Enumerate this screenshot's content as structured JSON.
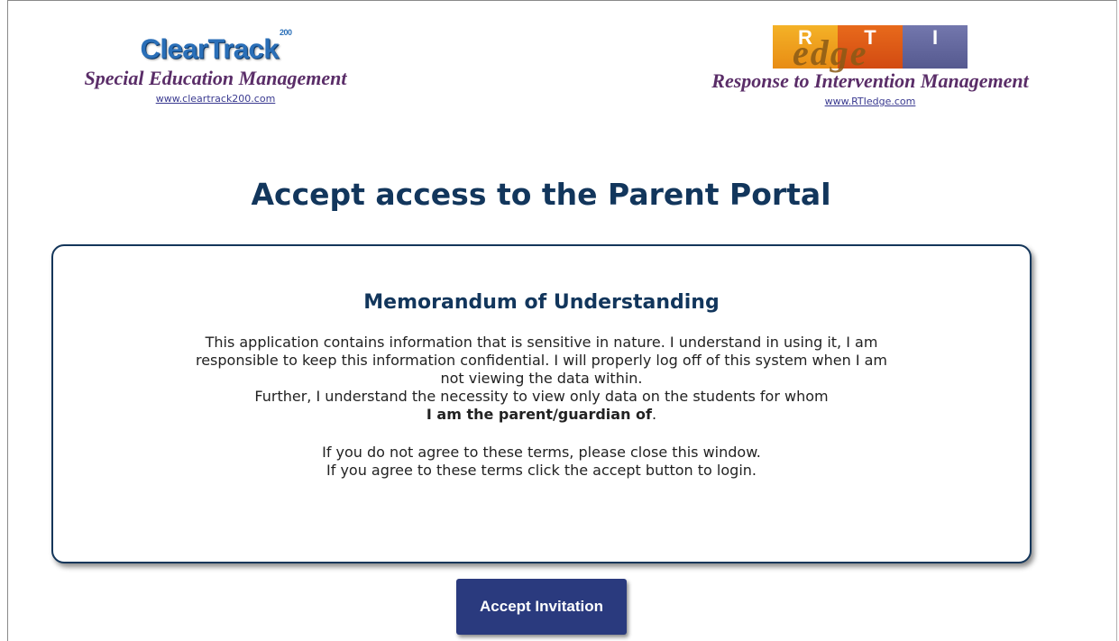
{
  "header": {
    "left": {
      "logo_text": "ClearTrack",
      "logo_sup": "200",
      "tagline": "Special Education Management",
      "link": "www.cleartrack200.com"
    },
    "right": {
      "logo_letters": [
        "R",
        "T",
        "I"
      ],
      "logo_script": "edge",
      "tagline": "Response to Intervention Management",
      "link": "www.RTIedge.com"
    }
  },
  "page_title": "Accept access to the Parent Portal",
  "memo": {
    "heading": "Memorandum of Understanding",
    "lines": [
      "This application contains information that is sensitive in nature. I understand in using it, I am",
      "responsible to keep this information confidential. I will properly log off of this system when I am",
      "not viewing the data within.",
      "Further, I understand the necessity to view only data on the students for whom"
    ],
    "strong_line": "I am the parent/guardian of",
    "strong_suffix": ".",
    "footer_lines": [
      "If you do not agree to these terms, please close this window.",
      "If you agree to these terms click the accept button to login."
    ]
  },
  "accept_button_label": "Accept Invitation",
  "colors": {
    "title": "#12365c",
    "button": "#2a3a7e",
    "tagline": "#5a2d68",
    "logo_blue": "#2a6fb8"
  }
}
